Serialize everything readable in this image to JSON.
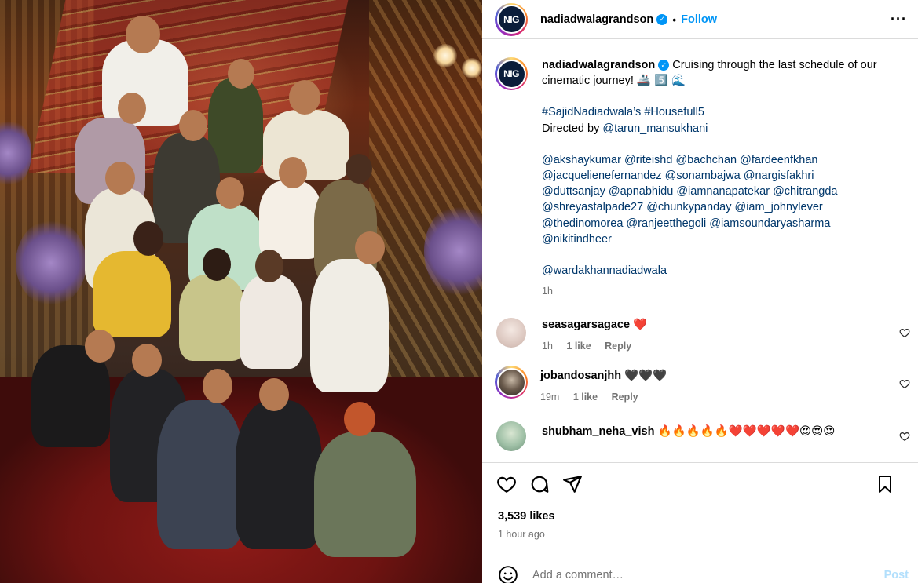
{
  "account": {
    "username": "nadiadwalagrandson",
    "avatar_text": "NIG",
    "verified_icon": "verified-badge-icon",
    "follow_label": "Follow",
    "separator": "•",
    "more_icon": "more-options-icon"
  },
  "caption": {
    "username": "nadiadwalagrandson",
    "text": "Cruising through the last schedule of our cinematic journey! 🚢 5️⃣ 🌊",
    "hashtags": "#SajidNadiadwala’s #Housefull5",
    "directed_prefix": "Directed by",
    "director": "@tarun_mansukhani",
    "mentions": [
      "@akshaykumar @riteishd @bachchan @fardeenfkhan",
      "@jacquelienefernandez @sonambajwa @nargisfakhri",
      "@duttsanjay @apnabhidu @iamnanapatekar @chitrangda",
      "@shreyastalpade27 @chunkypanday @iam_johnylever",
      "@thedinomorea @ranjeetthegoli @iamsoundaryasharma",
      "@nikitindheer"
    ],
    "final_mention": "@wardakhannadiadwala",
    "time": "1h"
  },
  "comments": [
    {
      "username": "seasagarsagace",
      "text": "❤️",
      "time": "1h",
      "likes": "1 like",
      "reply": "Reply",
      "avatar_color": "#e7d6cf"
    },
    {
      "username": "jobandosanjhh",
      "text": "🖤🖤🖤",
      "time": "19m",
      "likes": "1 like",
      "reply": "Reply",
      "avatar_color": "#3b3a38"
    },
    {
      "username": "shubham_neha_vish",
      "text": "🔥🔥🔥🔥🔥❤️❤️❤️❤️❤️😍😍😍",
      "avatar_color": "#9fc0a6"
    }
  ],
  "actions": {
    "like_icon": "heart-icon",
    "comment_icon": "comment-icon",
    "share_icon": "share-icon",
    "save_icon": "bookmark-icon",
    "likes": "3,539 likes",
    "time_ago": "1 hour ago",
    "emoji_icon": "emoji-icon",
    "comment_placeholder": "Add a comment…",
    "post_label": "Post"
  },
  "colors": {
    "accent": "#0095f6",
    "link": "#00376b",
    "muted": "#737373",
    "border": "#dbdbdb"
  }
}
